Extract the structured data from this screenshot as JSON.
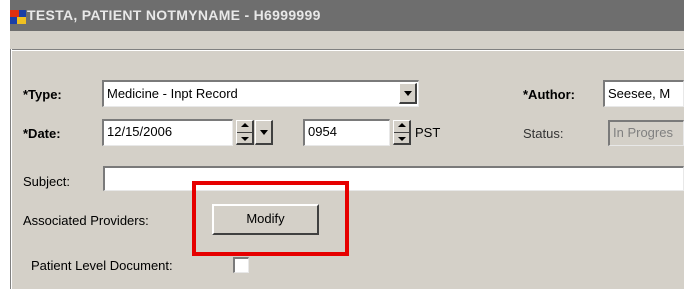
{
  "window": {
    "title": "TESTA, PATIENT NOTMYNAME - H6999999",
    "icon": "app-icon"
  },
  "form": {
    "type_label": "*Type:",
    "type_value": "Medicine - Inpt Record",
    "author_label": "*Author:",
    "author_value": "Seesee, M",
    "date_label": "*Date:",
    "date_value": "12/15/2006",
    "time_value": "0954",
    "timezone": "PST",
    "status_label": "Status:",
    "status_value": "In Progres",
    "subject_label": "Subject:",
    "subject_value": "",
    "assoc_label": "Associated Providers:",
    "modify_label": "Modify",
    "patient_level_label": "Patient Level Document:",
    "patient_level_checked": false
  },
  "colors": {
    "highlight": "#e60000",
    "titlebar": "#6e6e6e",
    "face": "#d4d0c8"
  }
}
